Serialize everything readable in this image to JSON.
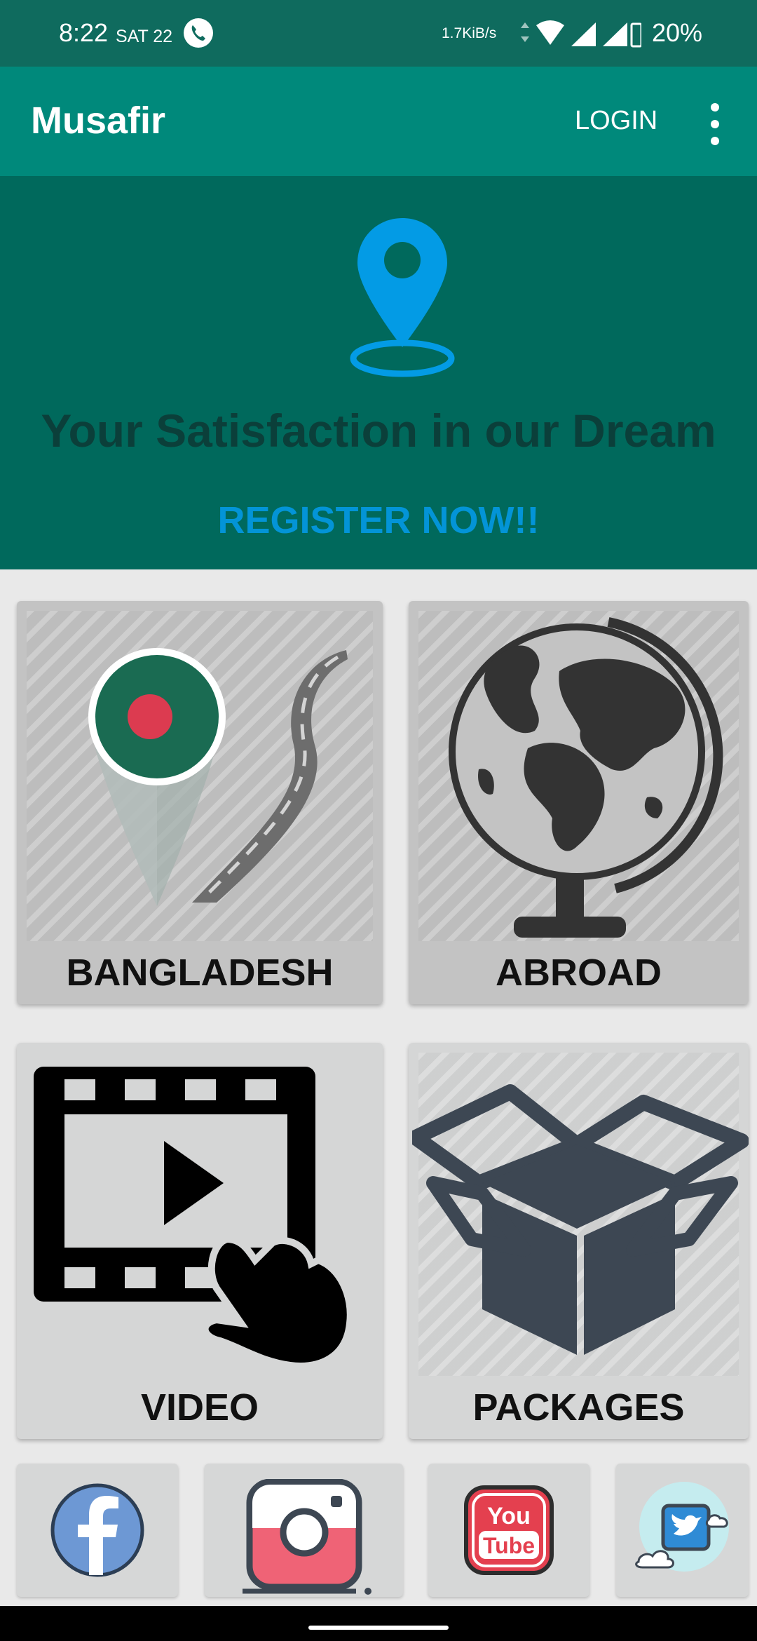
{
  "status": {
    "time": "8:22",
    "day": "SAT 22",
    "speed": "1.7KiB/s",
    "battery": "20%"
  },
  "app_bar": {
    "title": "Musafir",
    "login_label": "LOGIN"
  },
  "hero": {
    "tagline": "Your Satisfaction in our Dream",
    "register_label": "REGISTER NOW!!"
  },
  "tiles": {
    "bangladesh": "BANGLADESH",
    "abroad": "ABROAD",
    "video": "VIDEO",
    "packages": "PACKAGES"
  },
  "icons": {
    "location_pin": "location-pin-icon",
    "bangladesh": "bangladesh-map-road-icon",
    "abroad": "globe-icon",
    "video": "video-player-icon",
    "packages": "open-box-icon",
    "facebook": "facebook-icon",
    "instagram": "instagram-icon",
    "youtube": "youtube-icon",
    "twitter": "twitter-icon"
  },
  "colors": {
    "app_bar": "#00897b",
    "hero": "#00695c",
    "accent": "#0394d7"
  }
}
